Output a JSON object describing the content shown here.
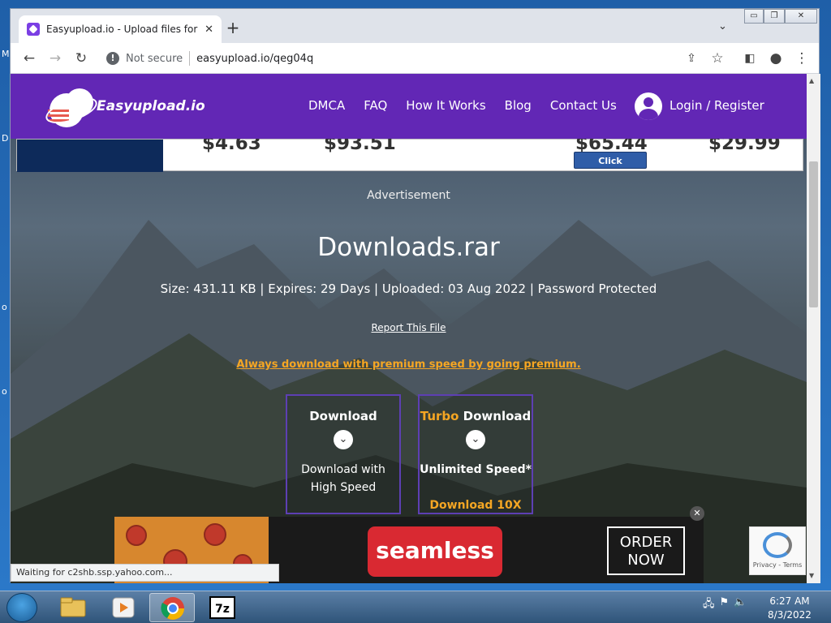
{
  "desktop": {
    "letters": [
      "M",
      "D",
      "o",
      "o"
    ]
  },
  "browser": {
    "tab_title": "Easyupload.io - Upload files for f",
    "tab_close": "✕",
    "new_tab": "+",
    "window_buttons": {
      "minimize": "▭",
      "maximize": "❐",
      "close": "✕"
    },
    "toolbar": {
      "back": "←",
      "forward": "→",
      "reload": "↻",
      "security_label": "Not secure",
      "url": "easyupload.io/qeg04q"
    },
    "status_text": "Waiting for c2shb.ssp.yahoo.com..."
  },
  "site": {
    "brand": "Easyupload.io",
    "menu": [
      "DMCA",
      "FAQ",
      "How It Works",
      "Blog",
      "Contact Us"
    ],
    "login": "Login / Register",
    "ad_top": {
      "prices": [
        "$4.63",
        "$93.51",
        "$65.44",
        "$29.99"
      ],
      "click_label": "Click"
    },
    "ad_label": "Advertisement",
    "file_name": "Downloads.rar",
    "file_meta": "Size: 431.11 KB | Expires: 29 Days | Uploaded: 03 Aug 2022 | Password Protected",
    "report_link": "Report This File",
    "premium_link": "Always download with premium speed by going premium.",
    "download_free": {
      "title": "Download",
      "subtitle": "Download with High Speed"
    },
    "download_turbo": {
      "title_highlight": "Turbo",
      "title_rest": " Download",
      "subtitle": "Unlimited Speed*",
      "footer": "Download 10X"
    },
    "ad_bottom": {
      "brand": "seamless",
      "cta": "ORDER NOW",
      "close": "✕"
    },
    "recaptcha": {
      "text": "Privacy - Terms"
    }
  },
  "taskbar": {
    "apps": [
      "explorer-icon",
      "media-player-icon",
      "chrome-icon",
      "7zip-icon"
    ],
    "time": "6:27 AM",
    "date": "8/3/2022"
  },
  "colors": {
    "brand_purple": "#6227b5",
    "premium_orange": "#f5a623",
    "seamless_red": "#d92932"
  }
}
